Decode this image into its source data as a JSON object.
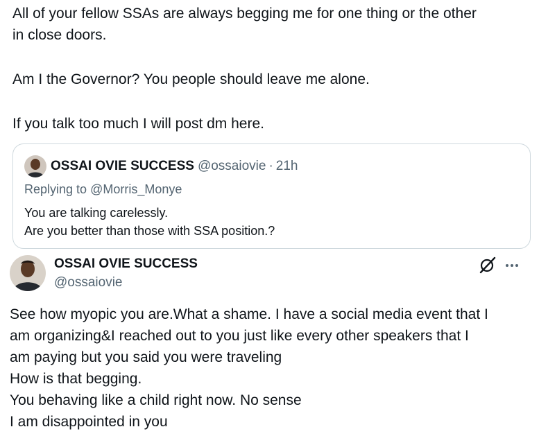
{
  "top_tweet": {
    "lines": [
      "All of your fellow SSAs are always begging me for one thing or the other",
      "in close doors.",
      "Am I the Governor? You people should leave me alone.",
      "If you talk too much I will post dm here."
    ]
  },
  "quoted_tweet": {
    "display_name": "OSSAI OVIE SUCCESS",
    "handle": "@ossaiovie",
    "separator": "·",
    "time": "21h",
    "replying_prefix": "Replying to",
    "replying_to": "@Morris_Monye",
    "lines": [
      "You are talking carelessly.",
      "Are you better than those with SSA position.?"
    ]
  },
  "reply_tweet": {
    "display_name": "OSSAI OVIE SUCCESS",
    "handle": "@ossaiovie",
    "icons": {
      "grok": "grok-icon",
      "more": "more-icon"
    },
    "lines": [
      "See how myopic you are.What a shame. I have a social media event that I",
      "am organizing&I reached out to you just like every other speakers that I",
      "am paying but you said you were traveling",
      "How is that begging.",
      "You behaving like a child right now. No sense",
      "I am disappointed in you"
    ]
  },
  "colors": {
    "text": "#0f1419",
    "secondary": "#536471",
    "border": "#cfd9de"
  }
}
